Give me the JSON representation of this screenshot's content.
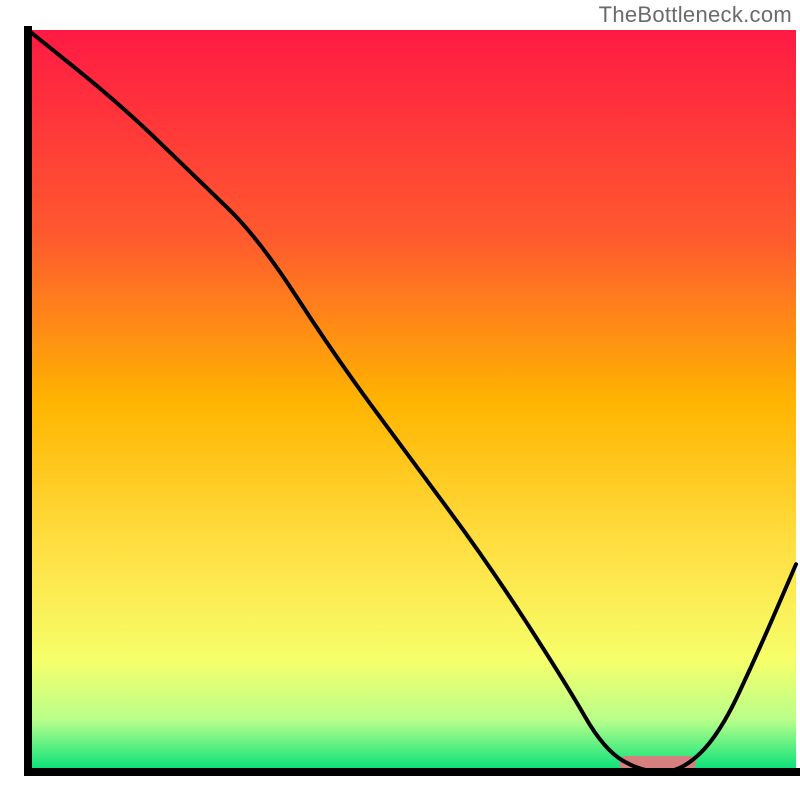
{
  "watermark": "TheBottleneck.com",
  "chart_data": {
    "type": "line",
    "title": "",
    "xlabel": "",
    "ylabel": "",
    "xlim": [
      0,
      100
    ],
    "ylim": [
      0,
      100
    ],
    "x": [
      0,
      12,
      22,
      30,
      40,
      50,
      60,
      70,
      75,
      80,
      85,
      90,
      95,
      100
    ],
    "values": [
      100,
      90,
      80,
      72,
      56,
      42,
      28,
      12,
      3,
      0,
      0,
      5,
      16,
      28
    ],
    "note": "x is horizontal position in %, values are height in % of plot area; approximate read from the curve",
    "gradient_stops": [
      {
        "offset": 0.0,
        "color": "#ff1a44"
      },
      {
        "offset": 0.28,
        "color": "#ff5a2e"
      },
      {
        "offset": 0.5,
        "color": "#ffb400"
      },
      {
        "offset": 0.7,
        "color": "#ffe043"
      },
      {
        "offset": 0.85,
        "color": "#f6ff6a"
      },
      {
        "offset": 0.93,
        "color": "#b8ff8a"
      },
      {
        "offset": 1.0,
        "color": "#00e07a"
      }
    ],
    "marker": {
      "x_center": 82,
      "width": 10,
      "color": "#d67f7f"
    },
    "curve_color": "#000000",
    "axis_color": "#000000"
  }
}
